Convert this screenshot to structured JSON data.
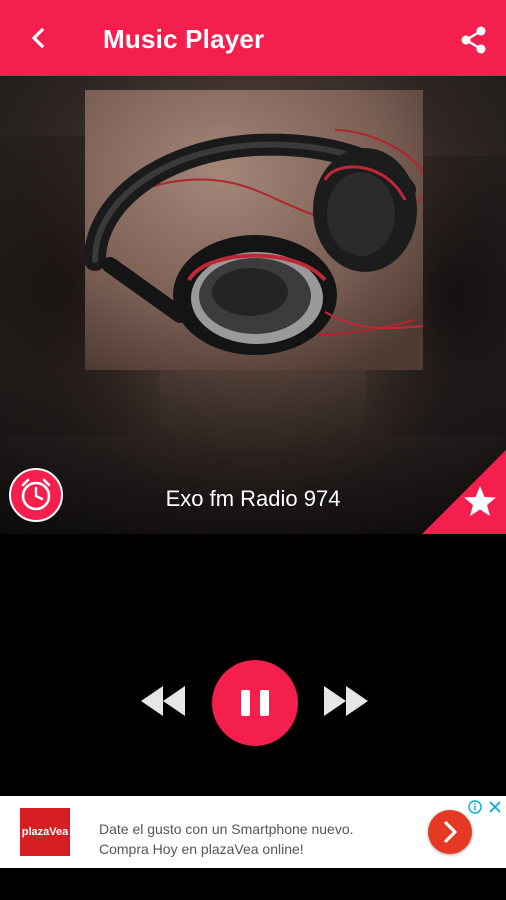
{
  "header": {
    "title": "Music Player",
    "back_icon": "arrow-back-icon",
    "share_icon": "share-icon",
    "color": "#f51f4e"
  },
  "player": {
    "station_name": "Exo fm Radio 974",
    "cover_icon": "headphones-artwork",
    "timer_icon": "alarm-clock-icon",
    "favorite_icon": "star-icon",
    "state": "playing",
    "controls": {
      "rewind_icon": "rewind-icon",
      "pause_icon": "pause-icon",
      "forward_icon": "fast-forward-icon"
    }
  },
  "ad": {
    "brand_logo": "plazaVea",
    "line1": "Date el gusto con un Smartphone nuevo.",
    "line2": "Compra Hoy en plazaVea online!",
    "cta_icon": "chevron-right-icon",
    "info_icon": "info-icon",
    "close_icon": "close-icon"
  }
}
